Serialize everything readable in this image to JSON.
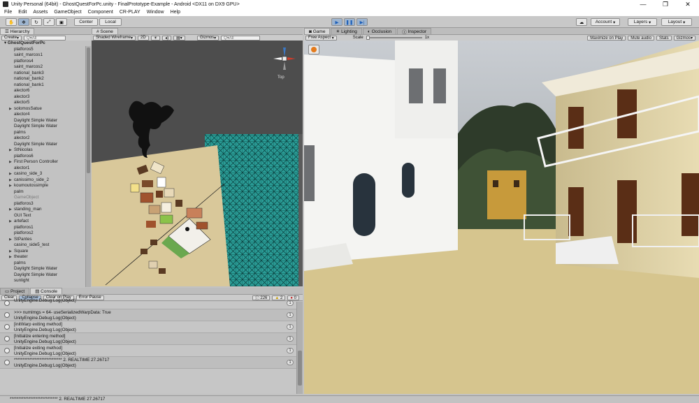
{
  "window": {
    "title": "Unity Personal (64bit) - GhostQuestForPc.unity - FinalPrototype-Example - Android <DX11 on DX9 GPU>",
    "minimize": "—",
    "maximize": "❐",
    "close": "✕"
  },
  "menu": [
    "File",
    "Edit",
    "Assets",
    "GameObject",
    "Component",
    "CR-PLAY",
    "Window",
    "Help"
  ],
  "toolbar": {
    "center": "Center",
    "local": "Local",
    "account": "Account",
    "layers": "Layers",
    "layout": "Layout"
  },
  "hierarchy": {
    "tab": "Hierarchy",
    "create": "Create",
    "search": "Q▾All",
    "root": "GhostQuestForPc",
    "items": [
      {
        "label": "platforos5",
        "fold": false
      },
      {
        "label": "saint_marcos1",
        "fold": false
      },
      {
        "label": "platforos4",
        "fold": false
      },
      {
        "label": "saint_marcos2",
        "fold": false
      },
      {
        "label": "national_bank3",
        "fold": false
      },
      {
        "label": "national_bank2",
        "fold": false
      },
      {
        "label": "national_bank1",
        "fold": false
      },
      {
        "label": "alector6",
        "fold": false
      },
      {
        "label": "alector3",
        "fold": false
      },
      {
        "label": "alector5",
        "fold": false
      },
      {
        "label": "solomosSatue",
        "fold": true
      },
      {
        "label": "alector4",
        "fold": false
      },
      {
        "label": "Daylight Simple Water",
        "fold": false
      },
      {
        "label": "Daylight Simple Water",
        "fold": false
      },
      {
        "label": "palms",
        "fold": false
      },
      {
        "label": "alector2",
        "fold": false
      },
      {
        "label": "Daylight Simple Water",
        "fold": false
      },
      {
        "label": "StNicolas",
        "fold": true
      },
      {
        "label": "platforos6",
        "fold": false
      },
      {
        "label": "First Person Controller",
        "fold": true
      },
      {
        "label": "alector1",
        "fold": false
      },
      {
        "label": "casino_side_3",
        "fold": true
      },
      {
        "label": "canissimo_side_2",
        "fold": true
      },
      {
        "label": "koumoutossimple",
        "fold": true
      },
      {
        "label": "palm",
        "fold": false
      },
      {
        "label": "GameObject",
        "fold": false,
        "dim": true
      },
      {
        "label": "platforos3",
        "fold": false
      },
      {
        "label": "standing_man",
        "fold": true
      },
      {
        "label": "GUI Text",
        "fold": false
      },
      {
        "label": "artefact",
        "fold": true
      },
      {
        "label": "platforos1",
        "fold": false
      },
      {
        "label": "platforos2",
        "fold": false
      },
      {
        "label": "StPantes",
        "fold": true
      },
      {
        "label": "casino_side5_test",
        "fold": false
      },
      {
        "label": "Square",
        "fold": true
      },
      {
        "label": "theater",
        "fold": true
      },
      {
        "label": "palms",
        "fold": false
      },
      {
        "label": "Daylight Simple Water",
        "fold": false
      },
      {
        "label": "Daylight Simple Water",
        "fold": false
      },
      {
        "label": "sunlight",
        "fold": false
      }
    ]
  },
  "scene": {
    "tab": "Scene",
    "shading": "Shaded Wireframe",
    "mode2d": "2D",
    "gizmos": "Gizmos",
    "search": "Q▾All",
    "view_label": "Top"
  },
  "game": {
    "tabs": [
      "Game",
      "Lighting",
      "Occlusion",
      "Inspector"
    ],
    "aspect": "Free Aspect",
    "scale_label": "Scale",
    "scale_value": "1x",
    "maximize": "Maximize on Play",
    "mute": "Mute audio",
    "stats": "Stats",
    "gizmos": "Gizmos"
  },
  "bottom_tabs": [
    "Project",
    "Console"
  ],
  "console": {
    "buttons": [
      "Clear",
      "Collapse",
      "Clear on Play",
      "Error Pause"
    ],
    "counts": {
      "log": "226",
      "warn": "2",
      "error": "0"
    },
    "rows": [
      {
        "l1": "UnityEngine.Debug:Log(Object)",
        "l2": "",
        "count": "1"
      },
      {
        "l1": ">>> numImgs = 64- useSerializedWarpData: True",
        "l2": "UnityEngine.Debug:Log(Object)",
        "count": "1"
      },
      {
        "l1": "[initWarp exiting method]",
        "l2": "UnityEngine.Debug:Log(Object)",
        "count": "1"
      },
      {
        "l1": "[Initialize entering method]",
        "l2": "UnityEngine.Debug:Log(Object)",
        "count": "1"
      },
      {
        "l1": "[Initialize exiting method]",
        "l2": "UnityEngine.Debug:Log(Object)",
        "count": "1"
      },
      {
        "l1": "**************************** 2. REALTIME 27.26717",
        "l2": "UnityEngine.Debug:Log(Object)",
        "count": "1"
      }
    ]
  },
  "status": "**************************** 2. REALTIME 27.26717",
  "colors": {
    "accent": "#3b78c4",
    "water": "#1f8f8a",
    "ground": "#d9c89a"
  }
}
